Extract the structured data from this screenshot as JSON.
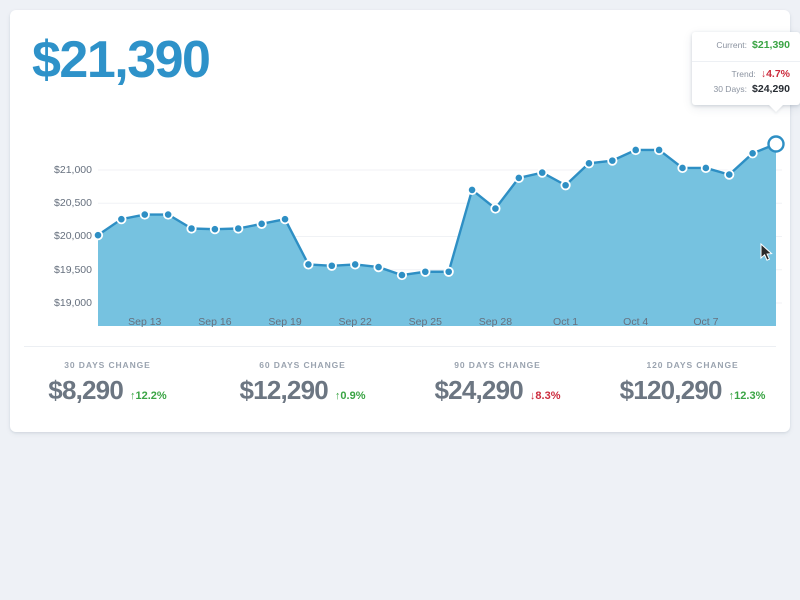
{
  "headline": {
    "value": "$21,390"
  },
  "tooltip": {
    "current_label": "Current:",
    "current_value": "$21,390",
    "trend_label": "Trend:",
    "trend_value": "↓4.7%",
    "days_label": "30 Days:",
    "days_value": "$24,290"
  },
  "stats": [
    {
      "label": "30 DAYS CHANGE",
      "value": "$8,290",
      "delta": "↑12.2%",
      "direction": "up"
    },
    {
      "label": "60 DAYS CHANGE",
      "value": "$12,290",
      "delta": "↑0.9%",
      "direction": "up"
    },
    {
      "label": "90 DAYS CHANGE",
      "value": "$24,290",
      "delta": "↓8.3%",
      "direction": "down"
    },
    {
      "label": "120 DAYS CHANGE",
      "value": "$120,290",
      "delta": "↑12.3%",
      "direction": "up"
    }
  ],
  "colors": {
    "accent": "#2e92c9",
    "area_fill": "#76c2e0",
    "line": "#2e8fc4",
    "positive": "#3aa444",
    "negative": "#cc2b3d",
    "page_bg": "#eef1f6"
  },
  "chart_data": {
    "type": "area",
    "title": "",
    "xlabel": "",
    "ylabel": "",
    "grid": true,
    "legend": null,
    "ylim": [
      18820,
      21420
    ],
    "yticks": [
      19000,
      19500,
      20000,
      20500,
      21000
    ],
    "ytick_labels": [
      "$19,000",
      "$19,500",
      "$20,000",
      "$20,500",
      "$21,000"
    ],
    "xtick_labels": [
      "Sep 13",
      "Sep 16",
      "Sep 19",
      "Sep 22",
      "Sep 25",
      "Sep 28",
      "Oct 1",
      "Oct 4",
      "Oct 7"
    ],
    "xtick_indices": [
      2,
      5,
      8,
      11,
      14,
      17,
      20,
      23,
      26
    ],
    "x": [
      "Sep 11",
      "Sep 12",
      "Sep 13",
      "Sep 14",
      "Sep 15",
      "Sep 16",
      "Sep 17",
      "Sep 18",
      "Sep 19",
      "Sep 20",
      "Sep 21",
      "Sep 22",
      "Sep 23",
      "Sep 24",
      "Sep 25",
      "Sep 26",
      "Sep 27",
      "Sep 28",
      "Sep 29",
      "Sep 30",
      "Oct 1",
      "Oct 2",
      "Oct 3",
      "Oct 4",
      "Oct 5",
      "Oct 6",
      "Oct 7",
      "Oct 8",
      "Oct 9",
      "Oct 10"
    ],
    "values": [
      20020,
      20260,
      20330,
      20330,
      20120,
      20110,
      20120,
      20190,
      20260,
      19580,
      19560,
      19580,
      19540,
      19420,
      19470,
      19470,
      20700,
      20420,
      20880,
      20960,
      20770,
      21100,
      21140,
      21300,
      21300,
      21030,
      21030,
      20930,
      21250,
      21390
    ],
    "active_point_index": 29,
    "active_point_value": 21390
  }
}
